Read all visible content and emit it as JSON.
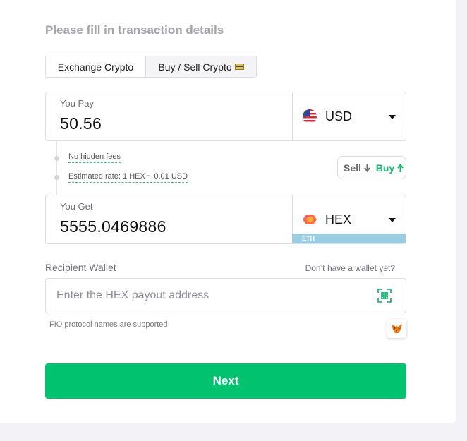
{
  "form": {
    "title": "Please fill in transaction details",
    "tabs": [
      {
        "label": "Exchange Crypto",
        "active": true
      },
      {
        "label": "Buy / Sell Crypto",
        "active": false
      }
    ]
  },
  "pay": {
    "label": "You Pay",
    "amount": "50.56",
    "currency": "USD",
    "flag_icon": "us-flag-icon"
  },
  "details": {
    "no_fees": "No hidden fees",
    "rate": "Estimated rate: 1 HEX ~ 0.01 USD"
  },
  "toggle": {
    "sell_label": "Sell",
    "buy_label": "Buy",
    "active": "buy"
  },
  "get": {
    "label": "You Get",
    "amount": "5555.0469886",
    "currency": "HEX",
    "network": "ETH",
    "token_icon": "hex-icon"
  },
  "wallet": {
    "label": "Recipient Wallet",
    "link": "Don’t have a wallet yet?",
    "placeholder": "Enter the HEX payout address",
    "value": "",
    "hint": "FIO protocol names are supported"
  },
  "actions": {
    "next": "Next"
  },
  "colors": {
    "accent": "#00c26f",
    "network_strip": "#9acde2",
    "muted_title": "#a3a3aa"
  }
}
